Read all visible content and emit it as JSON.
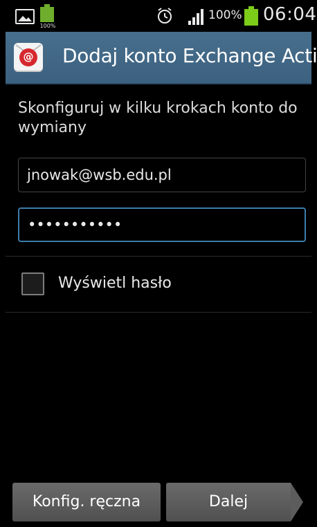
{
  "status_bar": {
    "small_battery_percent": "100%",
    "battery_percent": "100%",
    "time": "06:04",
    "icons": [
      "image-icon",
      "battery-small-icon",
      "alarm-icon",
      "signal-icon",
      "battery-icon"
    ],
    "battery_color": "#7ccc1a"
  },
  "action_bar": {
    "title": "Dodaj konto Exchange Activ..",
    "icon": "email-app-icon",
    "icon_glyph": "@",
    "background_color": "#476f8d"
  },
  "setup": {
    "instructions": "Skonfiguruj w kilku krokach konto do wymiany",
    "email_value": "jnowak@wsb.edu.pl",
    "password_value": "•••••••••••",
    "focus_color": "#3d7dab"
  },
  "show_password": {
    "label": "Wyświetl hasło",
    "checked": false
  },
  "buttons": {
    "manual_label": "Konfig. ręczna",
    "next_label": "Dalej"
  }
}
